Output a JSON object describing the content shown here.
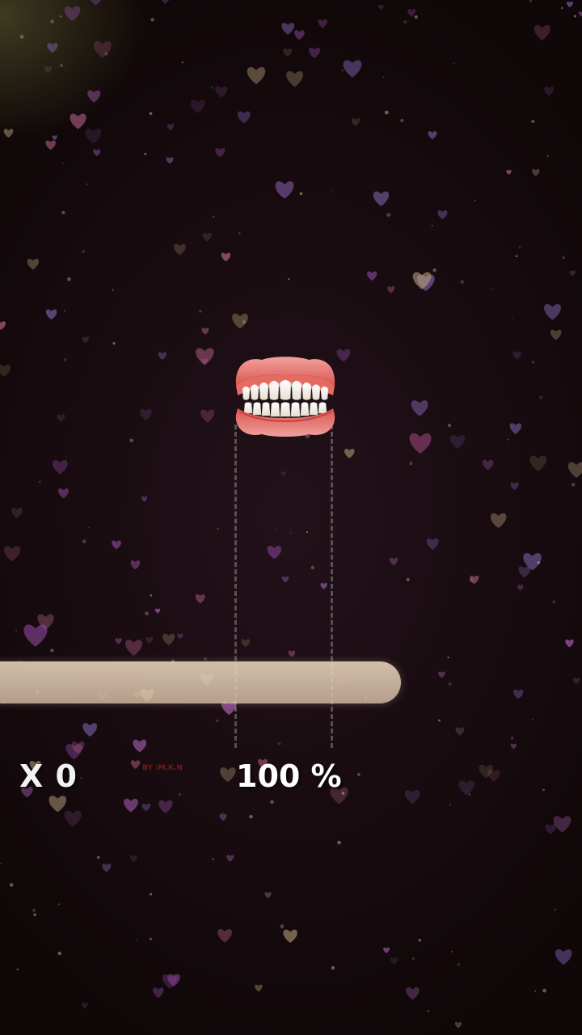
{
  "hud": {
    "multiplier": "X 0",
    "progress": "100 %",
    "progress_value": 100,
    "credit": "BY :M.K.N"
  },
  "character": {
    "icon": "false-teeth-icon"
  },
  "theme": {
    "heart_colors": [
      "#9a4fb0",
      "#c06fd0",
      "#b8a07a",
      "#8a6cc0",
      "#d070a0"
    ],
    "paddle_color": "#e6d2b8",
    "text_color": "#ffffff"
  }
}
